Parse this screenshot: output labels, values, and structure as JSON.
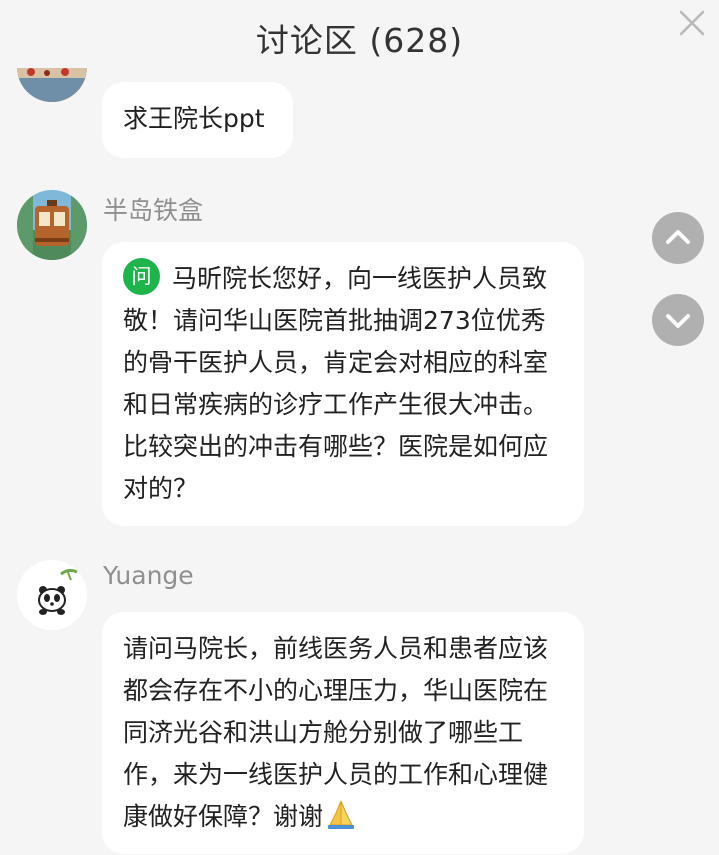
{
  "header": {
    "title": "讨论区 (628)"
  },
  "comments": [
    {
      "username": "",
      "text": "求王院长ppt",
      "avatar_icon": "landscape-photo-icon"
    },
    {
      "username": "半岛铁盒",
      "question_badge": "问",
      "text": "马昕院长您好，向一线医护人员致敬！请问华山医院首批抽调273位优秀的骨干医护人员，肯定会对相应的科室和日常疾病的诊疗工作产生很大冲击。比较突出的冲击有哪些？医院是如何应对的？",
      "avatar_icon": "tram-photo-icon"
    },
    {
      "username": "Yuange",
      "text": "请问马院长，前线医务人员和患者应该都会存在不小的心理压力，华山医院在同济光谷和洪山方舱分别做了哪些工作，来为一线医护人员的工作和心理健康做好保障？谢谢",
      "emoji": "praying-hands-icon",
      "avatar_icon": "panda-icon"
    }
  ],
  "controls": {
    "close_icon": "close-icon",
    "scroll_up_icon": "chevron-up-icon",
    "scroll_down_icon": "chevron-down-icon"
  },
  "colors": {
    "background": "#f5f5f5",
    "bubble": "#ffffff",
    "badge_green": "#1db54b",
    "nav_button": "#b0b0b0",
    "username": "#8f8f8f"
  }
}
